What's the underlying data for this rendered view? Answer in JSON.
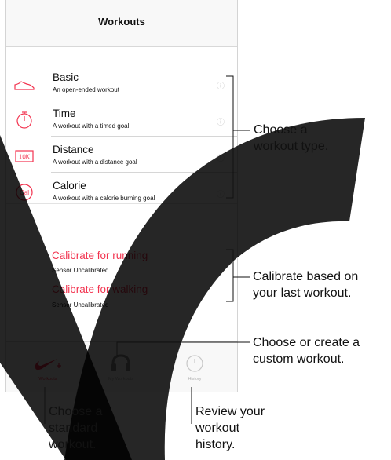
{
  "app": {
    "title": "Workouts"
  },
  "workouts": [
    {
      "title": "Basic",
      "subtitle": "An open-ended workout",
      "icon": "shoe-icon"
    },
    {
      "title": "Time",
      "subtitle": "A workout with a timed goal",
      "icon": "stopwatch-icon"
    },
    {
      "title": "Distance",
      "subtitle": "A workout with a distance goal",
      "icon": "distance-10k-icon",
      "icon_text": "10K"
    },
    {
      "title": "Calorie",
      "subtitle": "A workout with a calorie burning goal",
      "icon": "calorie-icon",
      "icon_text": "Cal"
    }
  ],
  "calibration": [
    {
      "title": "Calibrate for running",
      "status": "Sensor Uncalibrated"
    },
    {
      "title": "Calibrate for walking",
      "status": "Sensor Uncalibrated"
    }
  ],
  "tabs": [
    {
      "label": "Workouts",
      "icon": "nike-swoosh-plus-icon",
      "active": true
    },
    {
      "label": "My Workouts",
      "icon": "headphones-icon",
      "active": false
    },
    {
      "label": "History",
      "icon": "history-icon",
      "active": false
    }
  ],
  "callouts": {
    "workout_type": [
      "Choose a",
      "workout type."
    ],
    "calibrate": [
      "Calibrate based on",
      "your last workout."
    ],
    "custom": [
      "Choose or create a",
      "custom workout."
    ],
    "standard": [
      "Choose a",
      "standard",
      "workout."
    ],
    "history": [
      "Review your",
      "workout",
      "history."
    ]
  },
  "colors": {
    "accent": "#f2334f",
    "watermark": "#000000",
    "divider": "#d6d6d6"
  }
}
